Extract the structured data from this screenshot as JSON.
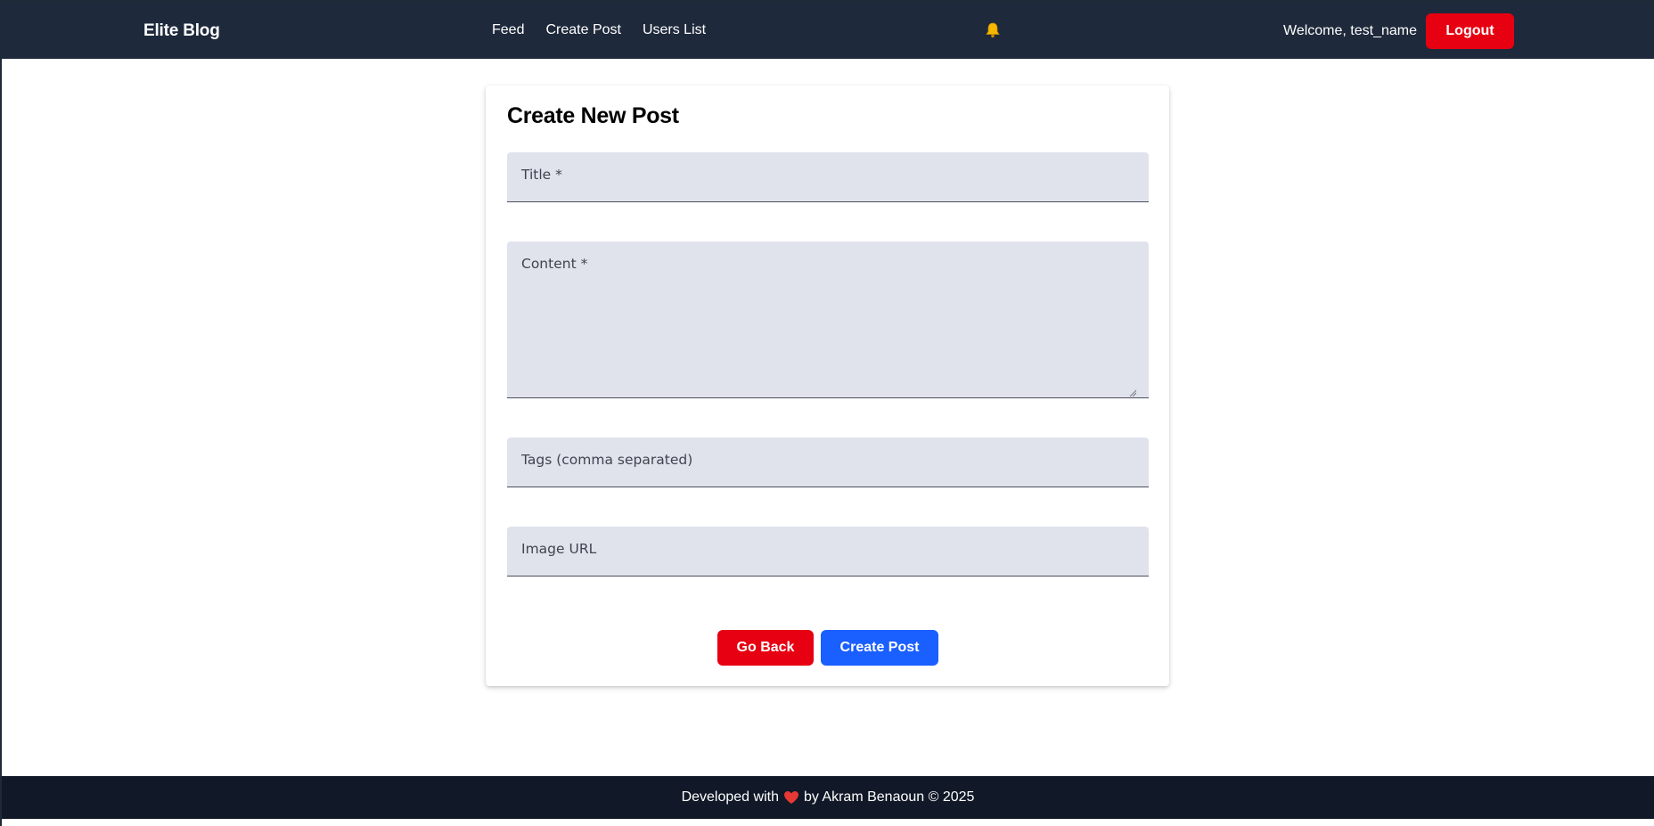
{
  "navbar": {
    "brand": "Elite Blog",
    "links": [
      {
        "label": "Feed"
      },
      {
        "label": "Create Post"
      },
      {
        "label": "Users List"
      }
    ],
    "notification_icon": "bell-icon",
    "welcome": "Welcome, test_name",
    "logout_label": "Logout"
  },
  "form": {
    "heading": "Create New Post",
    "fields": {
      "title": {
        "label": "Title *",
        "value": ""
      },
      "content": {
        "label": "Content *",
        "value": ""
      },
      "tags": {
        "label": "Tags (comma separated)",
        "value": ""
      },
      "image_url": {
        "label": "Image URL",
        "value": ""
      }
    },
    "back_label": "Go Back",
    "submit_label": "Create Post"
  },
  "footer": {
    "prefix": "Developed with",
    "icon": "heart-icon",
    "suffix": "by Akram Benaoun © 2025"
  },
  "colors": {
    "navbar_bg": "#1e293b",
    "footer_bg": "#111827",
    "danger": "#e60012",
    "primary": "#1a5fff",
    "field_bg": "#e0e3ec",
    "bell": "#f5b800",
    "heart": "#e53935"
  }
}
